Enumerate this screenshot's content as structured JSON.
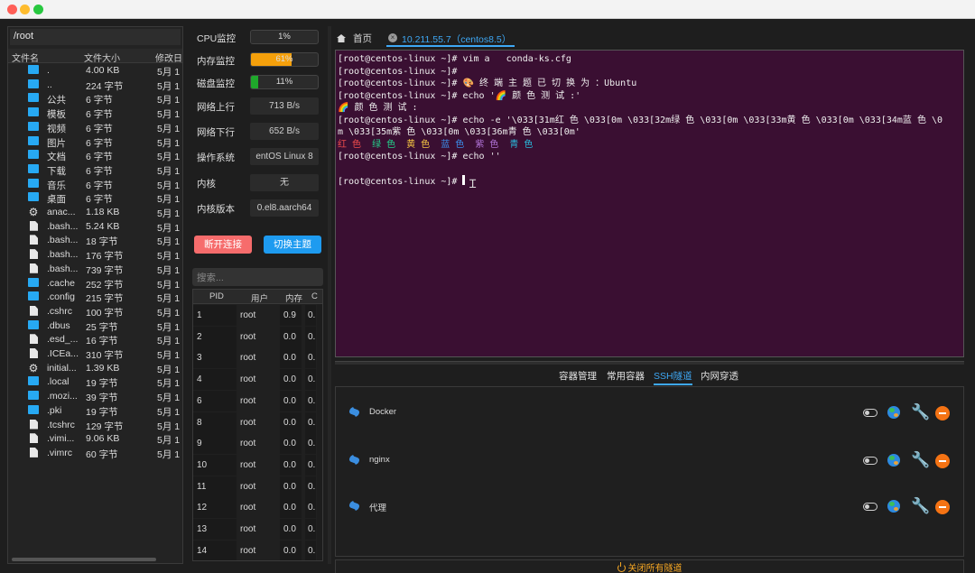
{
  "files": {
    "path": "/root",
    "headers": [
      "文件名",
      "文件大小",
      "修改日"
    ],
    "rows": [
      {
        "type": "folder",
        "name": ".",
        "size": "4.00 KB",
        "date": "5月 1"
      },
      {
        "type": "folder",
        "name": "..",
        "size": "224 字节",
        "date": "5月 1"
      },
      {
        "type": "folder",
        "name": "公共",
        "size": "6 字节",
        "date": "5月 1"
      },
      {
        "type": "folder",
        "name": "模板",
        "size": "6 字节",
        "date": "5月 1"
      },
      {
        "type": "folder",
        "name": "视频",
        "size": "6 字节",
        "date": "5月 1"
      },
      {
        "type": "folder",
        "name": "图片",
        "size": "6 字节",
        "date": "5月 1"
      },
      {
        "type": "folder",
        "name": "文档",
        "size": "6 字节",
        "date": "5月 1"
      },
      {
        "type": "folder",
        "name": "下载",
        "size": "6 字节",
        "date": "5月 1"
      },
      {
        "type": "folder",
        "name": "音乐",
        "size": "6 字节",
        "date": "5月 1"
      },
      {
        "type": "folder",
        "name": "桌面",
        "size": "6 字节",
        "date": "5月 1"
      },
      {
        "type": "gear",
        "name": "anac...",
        "size": "1.18 KB",
        "date": "5月 1"
      },
      {
        "type": "file",
        "name": ".bash...",
        "size": "5.24 KB",
        "date": "5月 1"
      },
      {
        "type": "file",
        "name": ".bash...",
        "size": "18 字节",
        "date": "5月 1"
      },
      {
        "type": "file",
        "name": ".bash...",
        "size": "176 字节",
        "date": "5月 1"
      },
      {
        "type": "file",
        "name": ".bash...",
        "size": "739 字节",
        "date": "5月 1"
      },
      {
        "type": "folder",
        "name": ".cache",
        "size": "252 字节",
        "date": "5月 1"
      },
      {
        "type": "folder",
        "name": ".config",
        "size": "215 字节",
        "date": "5月 1"
      },
      {
        "type": "file",
        "name": ".cshrc",
        "size": "100 字节",
        "date": "5月 1"
      },
      {
        "type": "folder",
        "name": ".dbus",
        "size": "25 字节",
        "date": "5月 1"
      },
      {
        "type": "file",
        "name": ".esd_...",
        "size": "16 字节",
        "date": "5月 1"
      },
      {
        "type": "file",
        "name": ".ICEa...",
        "size": "310 字节",
        "date": "5月 1"
      },
      {
        "type": "gear",
        "name": "initial...",
        "size": "1.39 KB",
        "date": "5月 1"
      },
      {
        "type": "folder",
        "name": ".local",
        "size": "19 字节",
        "date": "5月 1"
      },
      {
        "type": "folder",
        "name": ".mozi...",
        "size": "39 字节",
        "date": "5月 1"
      },
      {
        "type": "folder",
        "name": ".pki",
        "size": "19 字节",
        "date": "5月 1"
      },
      {
        "type": "file",
        "name": ".tcshrc",
        "size": "129 字节",
        "date": "5月 1"
      },
      {
        "type": "file",
        "name": ".vimi...",
        "size": "9.06 KB",
        "date": "5月 1"
      },
      {
        "type": "file",
        "name": ".vimrc",
        "size": "60 字节",
        "date": "5月 1"
      }
    ]
  },
  "monitor": {
    "cpu": {
      "label": "CPU监控",
      "value": "1%",
      "percent": 1,
      "color": "#2b2b2b"
    },
    "mem": {
      "label": "内存监控",
      "value": "61%",
      "percent": 61,
      "color": "#f5a00b"
    },
    "disk": {
      "label": "磁盘监控",
      "value": "11%",
      "percent": 11,
      "color": "#1fa82b"
    },
    "up": {
      "label": "网络上行",
      "value": "713 B/s"
    },
    "down": {
      "label": "网络下行",
      "value": "652 B/s"
    },
    "os": {
      "label": "操作系统",
      "value": "entOS Linux 8"
    },
    "kernel": {
      "label": "内核",
      "value": "无"
    },
    "kver": {
      "label": "内核版本",
      "value": "0.el8.aarch64"
    },
    "disconnect_label": "断开连接",
    "theme_label": "切换主题",
    "search_placeholder": "搜索...",
    "proc_headers": [
      "PID",
      "用户",
      "内存",
      "C"
    ],
    "procs": [
      {
        "pid": "1",
        "user": "root",
        "mem": "0.9",
        "cpu": "0."
      },
      {
        "pid": "2",
        "user": "root",
        "mem": "0.0",
        "cpu": "0."
      },
      {
        "pid": "3",
        "user": "root",
        "mem": "0.0",
        "cpu": "0."
      },
      {
        "pid": "4",
        "user": "root",
        "mem": "0.0",
        "cpu": "0."
      },
      {
        "pid": "6",
        "user": "root",
        "mem": "0.0",
        "cpu": "0."
      },
      {
        "pid": "8",
        "user": "root",
        "mem": "0.0",
        "cpu": "0."
      },
      {
        "pid": "9",
        "user": "root",
        "mem": "0.0",
        "cpu": "0."
      },
      {
        "pid": "10",
        "user": "root",
        "mem": "0.0",
        "cpu": "0."
      },
      {
        "pid": "11",
        "user": "root",
        "mem": "0.0",
        "cpu": "0."
      },
      {
        "pid": "12",
        "user": "root",
        "mem": "0.0",
        "cpu": "0."
      },
      {
        "pid": "13",
        "user": "root",
        "mem": "0.0",
        "cpu": "0."
      },
      {
        "pid": "14",
        "user": "root",
        "mem": "0.0",
        "cpu": "0."
      }
    ]
  },
  "tabs": {
    "home_label": "首页",
    "active_label": "10.211.55.7（centos8.5）"
  },
  "terminal": {
    "lines": [
      [
        {
          "t": "[root@centos-linux ~]# vim a   conda-ks.cfg"
        }
      ],
      [
        {
          "t": "[root@centos-linux ~]#"
        }
      ],
      [
        {
          "t": "[root@centos-linux ~]# 🎨 终 端 主 题 已 切 换 为 ：Ubuntu"
        }
      ],
      [
        {
          "t": "[root@centos-linux ~]# echo '🌈 颜 色 测 试 :'"
        }
      ],
      [
        {
          "t": "🌈 颜 色 测 试 :"
        }
      ],
      [
        {
          "t": "[root@centos-linux ~]# echo -e '\\033[31m红 色 \\033[0m \\033[32m绿 色 \\033[0m \\033[33m黄 色 \\033[0m \\033[34m蓝 色 \\0"
        }
      ],
      [
        {
          "t": "m \\033[35m紫 色 \\033[0m \\033[36m青 色 \\033[0m'"
        }
      ],
      [
        {
          "t": "红 色",
          "c": "c-red"
        },
        {
          "t": "  "
        },
        {
          "t": "绿 色",
          "c": "c-green"
        },
        {
          "t": "  "
        },
        {
          "t": "黄 色",
          "c": "c-yellow"
        },
        {
          "t": "  "
        },
        {
          "t": "蓝 色",
          "c": "c-blue"
        },
        {
          "t": "  "
        },
        {
          "t": "紫 色",
          "c": "c-purple"
        },
        {
          "t": "  "
        },
        {
          "t": "青 色",
          "c": "c-cyan"
        }
      ],
      [
        {
          "t": "[root@centos-linux ~]# echo ''"
        }
      ],
      [
        {
          "t": ""
        }
      ],
      [
        {
          "t": "[root@centos-linux ~]# "
        },
        {
          "cursor": true
        }
      ]
    ]
  },
  "bottom_tabs": [
    {
      "label": "容器管理",
      "active": false
    },
    {
      "label": "常用容器",
      "active": false
    },
    {
      "label": "SSH隧道",
      "active": true
    },
    {
      "label": "内网穿透",
      "active": false
    }
  ],
  "tunnels": [
    {
      "name": "Docker"
    },
    {
      "name": "nginx"
    },
    {
      "name": "代理"
    }
  ],
  "close_all_label": "关闭所有隧道"
}
